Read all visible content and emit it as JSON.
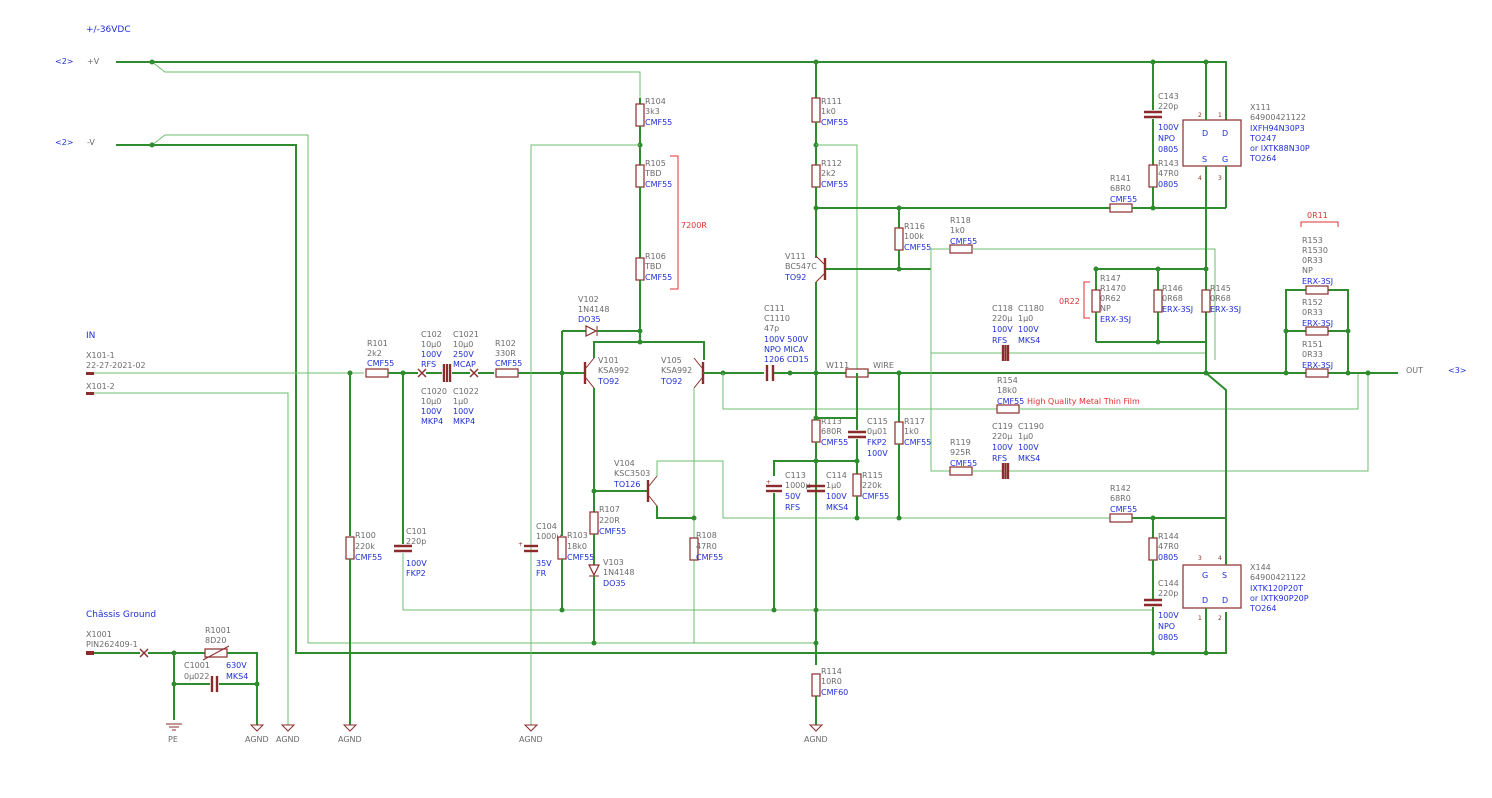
{
  "title": "+/-36VDC",
  "rails": {
    "pos_ref": "<2>",
    "pos_label": "+V",
    "neg_ref": "<2>",
    "neg_label": "-V"
  },
  "input": {
    "heading": "IN",
    "pin1": "X101-1",
    "part": "22-27-2021-02",
    "pin2": "X101-2"
  },
  "chassis": {
    "heading": "Châssis Ground",
    "conn": "X1001",
    "part": "PIN262409-1",
    "pe": "PE"
  },
  "output": {
    "label": "OUT",
    "ref": "<3>"
  },
  "gnd": "AGND",
  "annotations": {
    "r105_106": "7200R",
    "r146_147": "0R22",
    "r151_153": "0R11",
    "r154_note": "High Quality Metal Thin Film"
  },
  "components": [
    {
      "id": "r101",
      "ref": "R101",
      "val": "2k2",
      "pkg": "CMF55"
    },
    {
      "id": "r100",
      "ref": "R100",
      "val": "220k",
      "pkg": "CMF55"
    },
    {
      "id": "c101",
      "ref": "C101",
      "val": "220p",
      "pkg": "100V",
      "pkg2": "FKP2"
    },
    {
      "id": "c102",
      "ref": "C102",
      "val": "10µ0",
      "pkg": "100V",
      "pkg2": "RFS"
    },
    {
      "id": "c1021",
      "ref": "C1021",
      "val": "10µ0",
      "pkg": "250V",
      "pkg2": "MCAP"
    },
    {
      "id": "c1020",
      "ref": "C1020",
      "val": "10µ0",
      "pkg": "100V",
      "pkg2": "MKP4"
    },
    {
      "id": "c1022",
      "ref": "C1022",
      "val": "1µ0",
      "pkg": "100V",
      "pkg2": "MKP4"
    },
    {
      "id": "r102",
      "ref": "R102",
      "val": "330R",
      "pkg": "CMF55"
    },
    {
      "id": "r104",
      "ref": "R104",
      "val": "3k3",
      "pkg": "CMF55"
    },
    {
      "id": "r105",
      "ref": "R105",
      "val": "TBD",
      "pkg": "CMF55"
    },
    {
      "id": "r106",
      "ref": "R106",
      "val": "TBD",
      "pkg": "CMF55"
    },
    {
      "id": "v102",
      "ref": "V102",
      "val": "1N4148",
      "pkg": "DO35"
    },
    {
      "id": "v101",
      "ref": "V101",
      "val": "KSA992",
      "pkg": "TO92"
    },
    {
      "id": "v105",
      "ref": "V105",
      "val": "KSA992",
      "pkg": "TO92"
    },
    {
      "id": "c104",
      "ref": "C104",
      "val": "1000µ",
      "pkg": "35V",
      "pkg2": "FR"
    },
    {
      "id": "r103",
      "ref": "R103",
      "val": "18k0",
      "pkg": "CMF55"
    },
    {
      "id": "r107",
      "ref": "R107",
      "val": "220R",
      "pkg": "CMF55"
    },
    {
      "id": "v103",
      "ref": "V103",
      "val": "1N4148",
      "pkg": "DO35"
    },
    {
      "id": "v104",
      "ref": "V104",
      "val": "KSC3503",
      "pkg": "TO126"
    },
    {
      "id": "r108",
      "ref": "R108",
      "val": "47R0",
      "pkg": "CMF55"
    },
    {
      "id": "r111",
      "ref": "R111",
      "val": "1k0",
      "pkg": "CMF55"
    },
    {
      "id": "r112",
      "ref": "R112",
      "val": "2k2",
      "pkg": "CMF55"
    },
    {
      "id": "v111",
      "ref": "V111",
      "val": "BC547C",
      "pkg": "TO92"
    },
    {
      "id": "c111",
      "ref": "C111",
      "ref2": "C1110",
      "val": "47p",
      "pkg": "100V 500V",
      "pkg2": "NPO  MICA",
      "pkg3": "1206 CD15"
    },
    {
      "id": "w111",
      "ref": "W111",
      "val": "WIRE"
    },
    {
      "id": "r113",
      "ref": "R113",
      "val": "680R",
      "pkg": "CMF55"
    },
    {
      "id": "c115",
      "ref": "C115",
      "val": "0µ01",
      "pkg": "FKP2",
      "pkg2": "100V"
    },
    {
      "id": "r117",
      "ref": "R117",
      "val": "1k0",
      "pkg": "CMF55"
    },
    {
      "id": "c113",
      "ref": "C113",
      "val": "1000µ",
      "pkg": "50V",
      "pkg2": "RFS"
    },
    {
      "id": "c114",
      "ref": "C114",
      "val": "1µ0",
      "pkg": "100V",
      "pkg2": "MKS4"
    },
    {
      "id": "r115",
      "ref": "R115",
      "val": "220k",
      "pkg": "CMF55"
    },
    {
      "id": "r114",
      "ref": "R114",
      "val": "10R0",
      "pkg": "CMF60"
    },
    {
      "id": "r116",
      "ref": "R116",
      "val": "100k",
      "pkg": "CMF55"
    },
    {
      "id": "r118",
      "ref": "R118",
      "val": "1k0",
      "pkg": "CMF55"
    },
    {
      "id": "r119",
      "ref": "R119",
      "val": "925R",
      "pkg": "CMF55"
    },
    {
      "id": "c118",
      "ref": "C118",
      "ref2": "C1180",
      "val": "220µ",
      "val2": "1µ0",
      "pkg": "100V",
      "pkg2": "100V",
      "pkg3": "RFS",
      "pkg4": "MKS4"
    },
    {
      "id": "c119",
      "ref": "C119",
      "ref2": "C1190",
      "val": "220µ",
      "val2": "1µ0",
      "pkg": "100V",
      "pkg2": "100V",
      "pkg3": "RFS",
      "pkg4": "MKS4"
    },
    {
      "id": "r154",
      "ref": "R154",
      "val": "18k0",
      "pkg": "CMF55"
    },
    {
      "id": "r141",
      "ref": "R141",
      "val": "68R0",
      "pkg": "CMF55"
    },
    {
      "id": "r142",
      "ref": "R142",
      "val": "68R0",
      "pkg": "CMF55"
    },
    {
      "id": "c143",
      "ref": "C143",
      "val": "220p",
      "pkg": "100V",
      "pkg2": "NPO",
      "pkg3": "0805"
    },
    {
      "id": "r143",
      "ref": "R143",
      "val": "47R0",
      "pkg": "0805"
    },
    {
      "id": "r144",
      "ref": "R144",
      "val": "47R0",
      "pkg": "0805"
    },
    {
      "id": "c144",
      "ref": "C144",
      "val": "220p",
      "pkg": "100V",
      "pkg2": "NPO",
      "pkg3": "0805"
    },
    {
      "id": "r147",
      "ref": "R147",
      "ref2": "R1470",
      "val": "0R62",
      "val2": "NP",
      "pkg": "ERX-3SJ"
    },
    {
      "id": "r146",
      "ref": "R146",
      "val": "0R68",
      "pkg": "ERX-3SJ"
    },
    {
      "id": "r145",
      "ref": "R145",
      "val": "0R68",
      "pkg": "ERX-3SJ"
    },
    {
      "id": "r153",
      "ref": "R153",
      "ref2": "R1530",
      "val": "0R33",
      "val2": "NP",
      "pkg": "ERX-3SJ"
    },
    {
      "id": "r152",
      "ref": "R152",
      "val": "0R33",
      "pkg": "ERX-3SJ"
    },
    {
      "id": "r151",
      "ref": "R151",
      "val": "0R33",
      "pkg": "ERX-3SJ"
    },
    {
      "id": "x111",
      "ref": "X111",
      "val": "64900421122",
      "pkg": "IXFH94N30P3",
      "pkg2": "TO247",
      "pkg3": "or IXTK88N30P",
      "pkg4": "TO264"
    },
    {
      "id": "x144",
      "ref": "X144",
      "val": "64900421122",
      "pkg": "IXTK120P20T",
      "pkg2": "or IXTK90P20P",
      "pkg3": "TO264"
    },
    {
      "id": "r1001",
      "ref": "R1001",
      "val": "8D20"
    },
    {
      "id": "c1001",
      "ref": "C1001",
      "val": "0µ022",
      "pkg": "630V",
      "pkg2": "MKS4"
    }
  ],
  "pins": {
    "d": "D",
    "s": "S",
    "g": "G",
    "n1": "1",
    "n2": "2",
    "n3": "3",
    "n4": "4"
  }
}
